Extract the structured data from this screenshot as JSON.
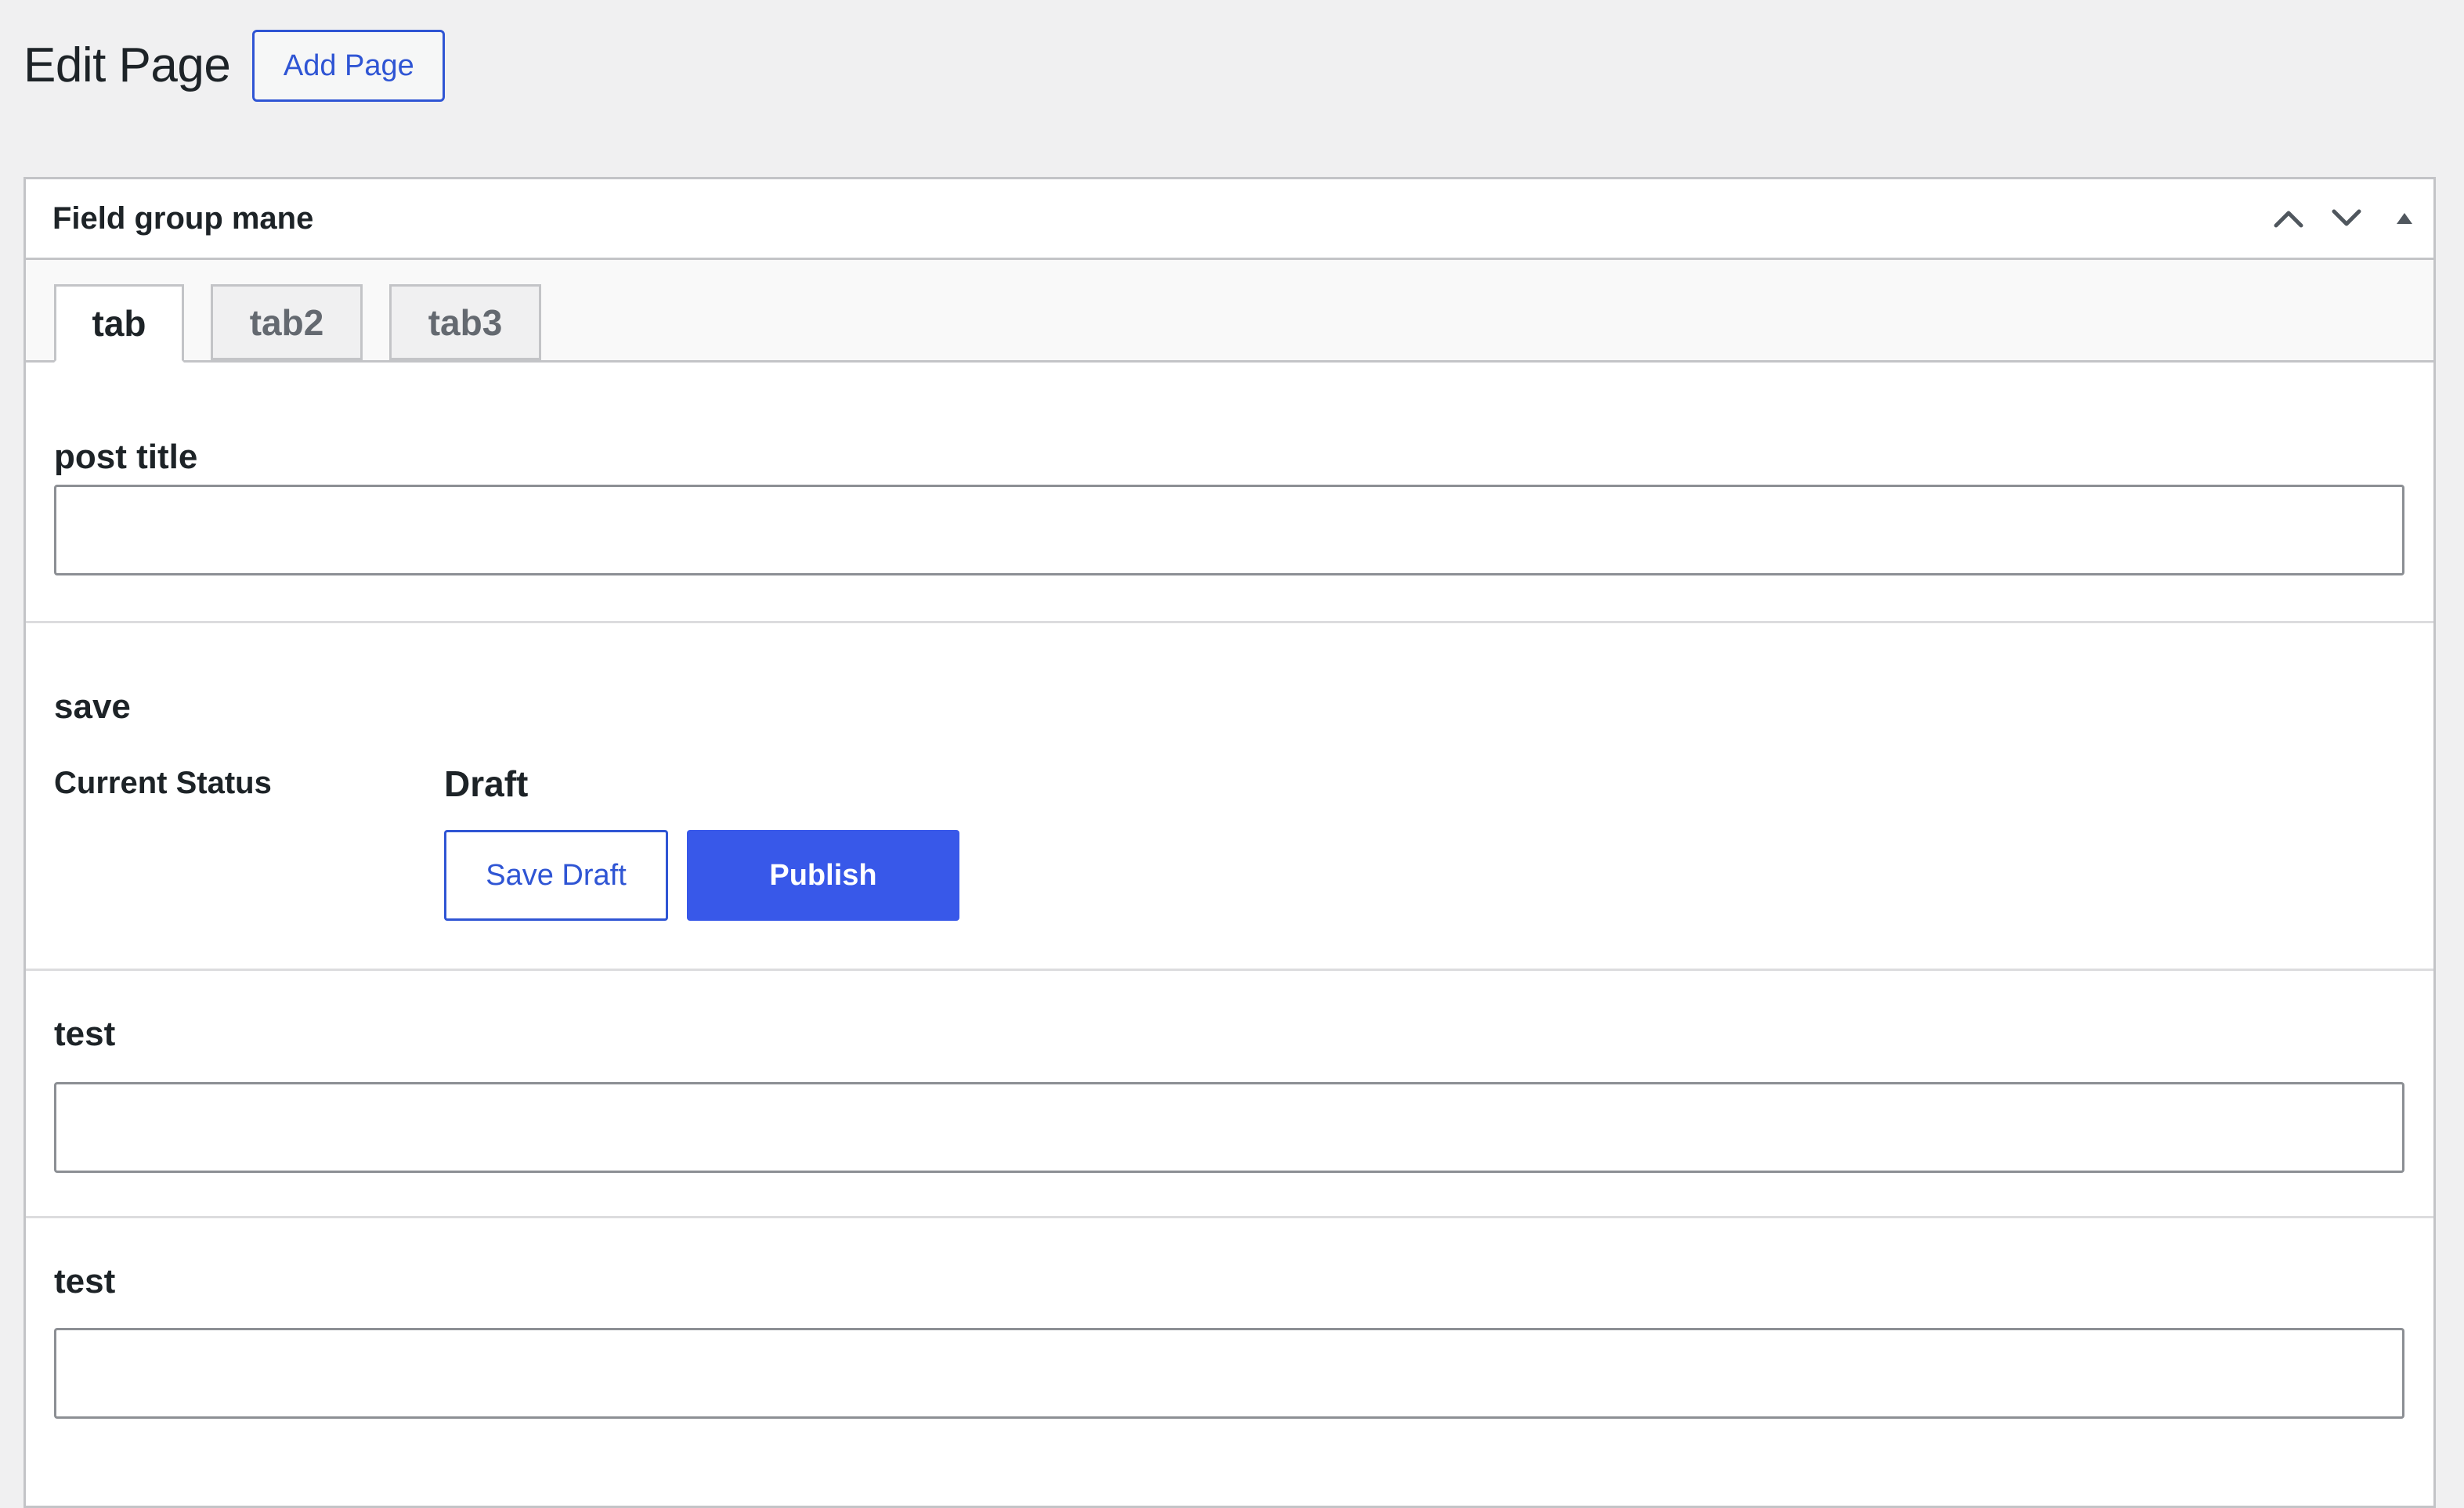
{
  "page": {
    "title": "Edit Page",
    "add_button_label": "Add Page"
  },
  "postbox": {
    "title": "Field group mane",
    "handle_icons": [
      "chevron-up-icon",
      "chevron-down-icon",
      "triangle-up-icon"
    ]
  },
  "tabs": [
    {
      "label": "tab",
      "active": true
    },
    {
      "label": "tab2",
      "active": false
    },
    {
      "label": "tab3",
      "active": false
    }
  ],
  "fields": {
    "post_title": {
      "label": "post title",
      "value": ""
    },
    "save": {
      "label": "save",
      "status_label": "Current Status",
      "status_value": "Draft",
      "save_draft_label": "Save Draft",
      "publish_label": "Publish"
    },
    "test_1": {
      "label": "test",
      "value": ""
    },
    "test_2": {
      "label": "test",
      "value": ""
    }
  },
  "colors": {
    "accent": "#3858e9",
    "link": "#2f55d4",
    "background": "#f0f0f1",
    "border": "#c3c4c7"
  }
}
